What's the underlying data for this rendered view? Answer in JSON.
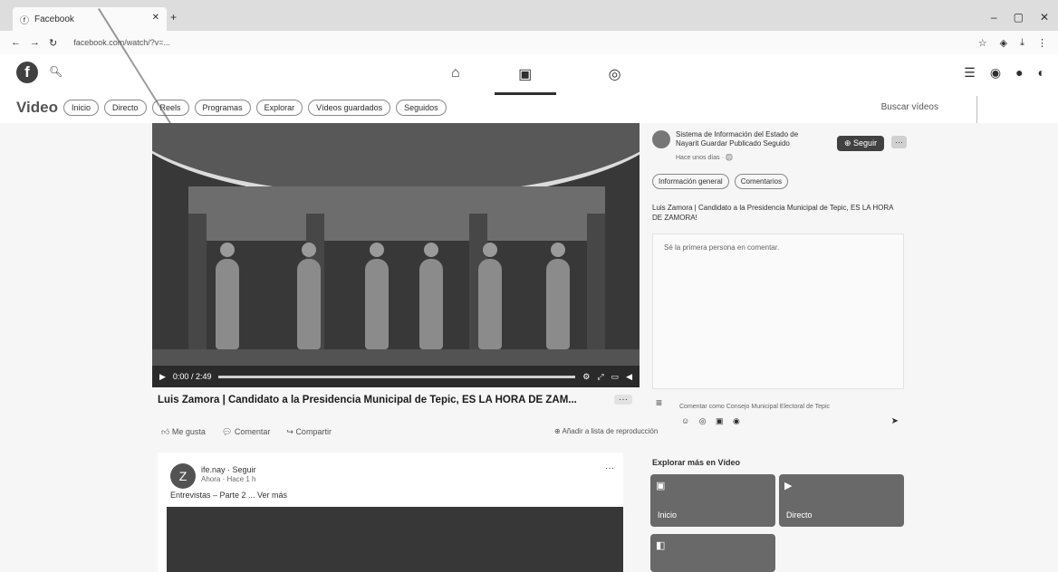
{
  "browser": {
    "tab_title": "Facebook",
    "url": "facebook.com/watch/?v=...",
    "new_tab": "+",
    "window_controls": [
      "–",
      "▢",
      "✕"
    ]
  },
  "header": {
    "logo_text": "f",
    "nav_icons": [
      "home-icon",
      "video-icon",
      "gaming-icon"
    ],
    "right_icons": [
      "menu-icon",
      "messenger-icon",
      "bell-icon",
      "avatar"
    ]
  },
  "video_nav": {
    "title": "Video",
    "pills": [
      "Inicio",
      "Directo",
      "Reels",
      "Programas",
      "Explorar",
      "Vídeos guardados",
      "Seguidos"
    ],
    "search_label": "Buscar vídeos"
  },
  "player": {
    "time": "0:00 / 2:49",
    "video_title": "Luis Zamora | Candidato a la Presidencia Municipal de Tepic, ES LA HORA DE ZAM...",
    "more": "···",
    "actions": [
      "Me gusta",
      "Comentar",
      "Compartir"
    ],
    "add_list": "Añadir a lista de reproducción"
  },
  "page": {
    "name": "Sistema de Información del Estado de Nayarit Guardar Publicado Seguido",
    "sub": "Hace unos días · 🌐",
    "follow_label": "Seguir",
    "more": "···",
    "tabs": [
      "Información general",
      "Comentarios"
    ],
    "description": "Luis Zamora | Candidato a la Presidencia Municipal de Tepic, ES LA HORA DE ZAMORA!",
    "comment_placeholder": "Sé la primera persona en comentar.",
    "commenter_text": "Comentar como Consejo Municipal Electoral de Tepic",
    "emojis": "☺ ◎ ▣ ◉",
    "send": "➤"
  },
  "feed_card": {
    "avatar": "Z",
    "name": "ife.nay · Seguir",
    "sub": "Ahora · Hace 1 h",
    "text": "Entrevistas – Parte 2 ... Ver más",
    "more": "···"
  },
  "explore": {
    "title": "Explorar más en Vídeo",
    "tiles": [
      {
        "label": "Inicio",
        "icon": "▣"
      },
      {
        "label": "Directo",
        "icon": "▶"
      },
      {
        "label": "",
        "icon": "◧"
      }
    ]
  }
}
